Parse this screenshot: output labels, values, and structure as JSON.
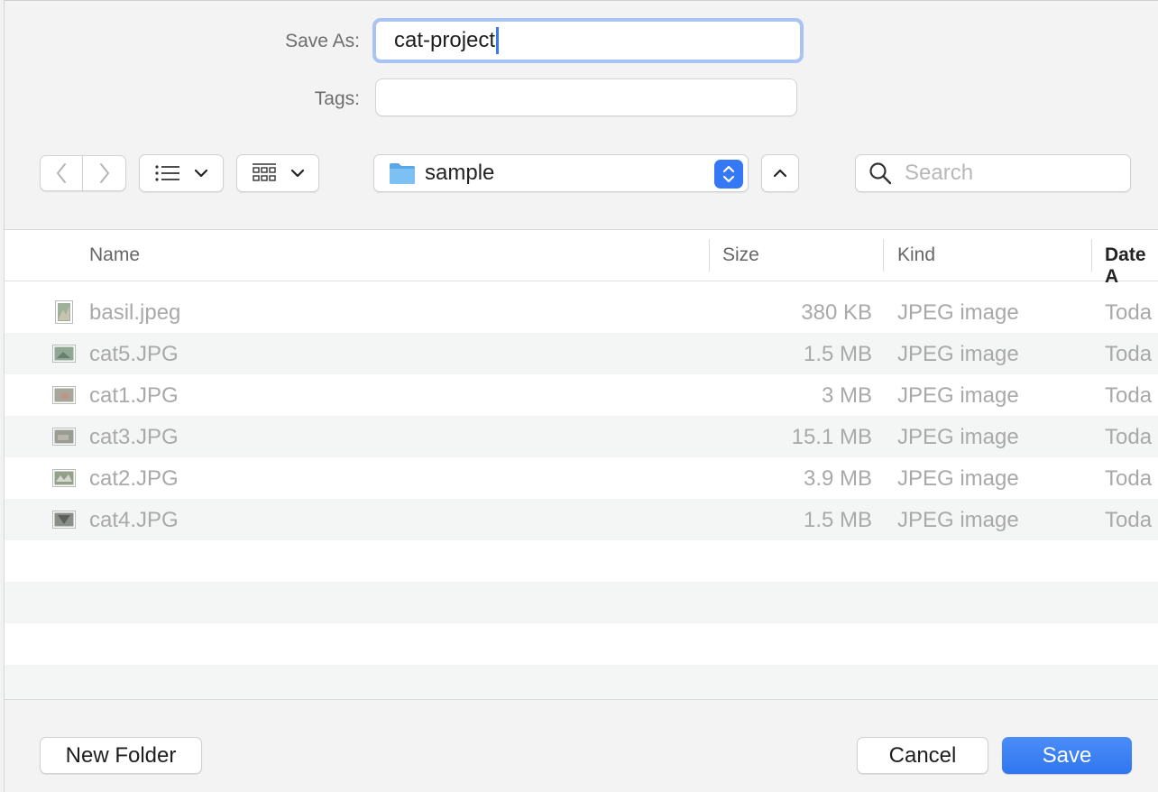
{
  "form": {
    "save_as_label": "Save As:",
    "save_as_value": "cat-project",
    "tags_label": "Tags:",
    "tags_value": ""
  },
  "toolbar": {
    "location": "sample",
    "search_placeholder": "Search"
  },
  "columns": {
    "name": "Name",
    "size": "Size",
    "kind": "Kind",
    "date": "Date A"
  },
  "files": [
    {
      "name": "basil.jpeg",
      "size": "380 KB",
      "kind": "JPEG image",
      "date": "Toda"
    },
    {
      "name": "cat5.JPG",
      "size": "1.5 MB",
      "kind": "JPEG image",
      "date": "Toda"
    },
    {
      "name": "cat1.JPG",
      "size": "3 MB",
      "kind": "JPEG image",
      "date": "Toda"
    },
    {
      "name": "cat3.JPG",
      "size": "15.1 MB",
      "kind": "JPEG image",
      "date": "Toda"
    },
    {
      "name": "cat2.JPG",
      "size": "3.9 MB",
      "kind": "JPEG image",
      "date": "Toda"
    },
    {
      "name": "cat4.JPG",
      "size": "1.5 MB",
      "kind": "JPEG image",
      "date": "Toda"
    }
  ],
  "buttons": {
    "new_folder": "New Folder",
    "cancel": "Cancel",
    "save": "Save"
  },
  "colors": {
    "accent": "#3478f6",
    "focus_ring": "#a9c3f2",
    "folder": "#6fb4ee"
  }
}
